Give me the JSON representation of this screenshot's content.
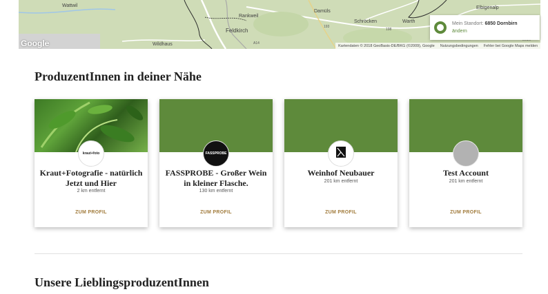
{
  "map": {
    "labels": {
      "wattwil": "Wattwil",
      "rankweil": "Rankweil",
      "feldkirch": "Feldkirch",
      "damuls": "Damüls",
      "schrocken": "Schröcken",
      "warth": "Warth",
      "elbigenalp": "Elbigenalp",
      "wildhaus": "Wildhaus",
      "hasslach": "Häselgehr",
      "a14": "A14",
      "r193": "193",
      "r198": "198",
      "leder": "Leder"
    },
    "google_logo": "Google",
    "footer": {
      "copyright": "Kartendaten © 2018 GeoBasis-DE/BKG (©2009), Google",
      "terms": "Nutzungsbedingungen",
      "report": "Fehler bei Google Maps melden"
    },
    "location": {
      "prefix": "Mein Standort:",
      "value": "6850 Dornbirn",
      "change": "ändern"
    },
    "colors": {
      "accent": "#5e8a3b",
      "map_bg": "#cfdcb7",
      "road": "#ffffff",
      "border": "#2b2b2b"
    }
  },
  "section1": {
    "title": "ProduzentInnen in deiner Nähe"
  },
  "producers": [
    {
      "name": "Kraut+Fotografie - natürlich Jetzt und Hier",
      "distance": "2 km entfernt",
      "link": "ZUM PROFIL",
      "avatar_text": "kraut+foto"
    },
    {
      "name": "FASSPROBE - Großer Wein in kleiner Flasche.",
      "distance": "130 km entfernt",
      "link": "ZUM PROFIL",
      "avatar_text": "FASSPROBE"
    },
    {
      "name": "Weinhof Neubauer",
      "distance": "201 km entfernt",
      "link": "ZUM PROFIL",
      "avatar_text": "NEUBAUER"
    },
    {
      "name": "Test Account",
      "distance": "201 km entfernt",
      "link": "ZUM PROFIL",
      "avatar_text": ""
    }
  ],
  "section2": {
    "title": "Unsere LieblingsproduzentInnen"
  }
}
